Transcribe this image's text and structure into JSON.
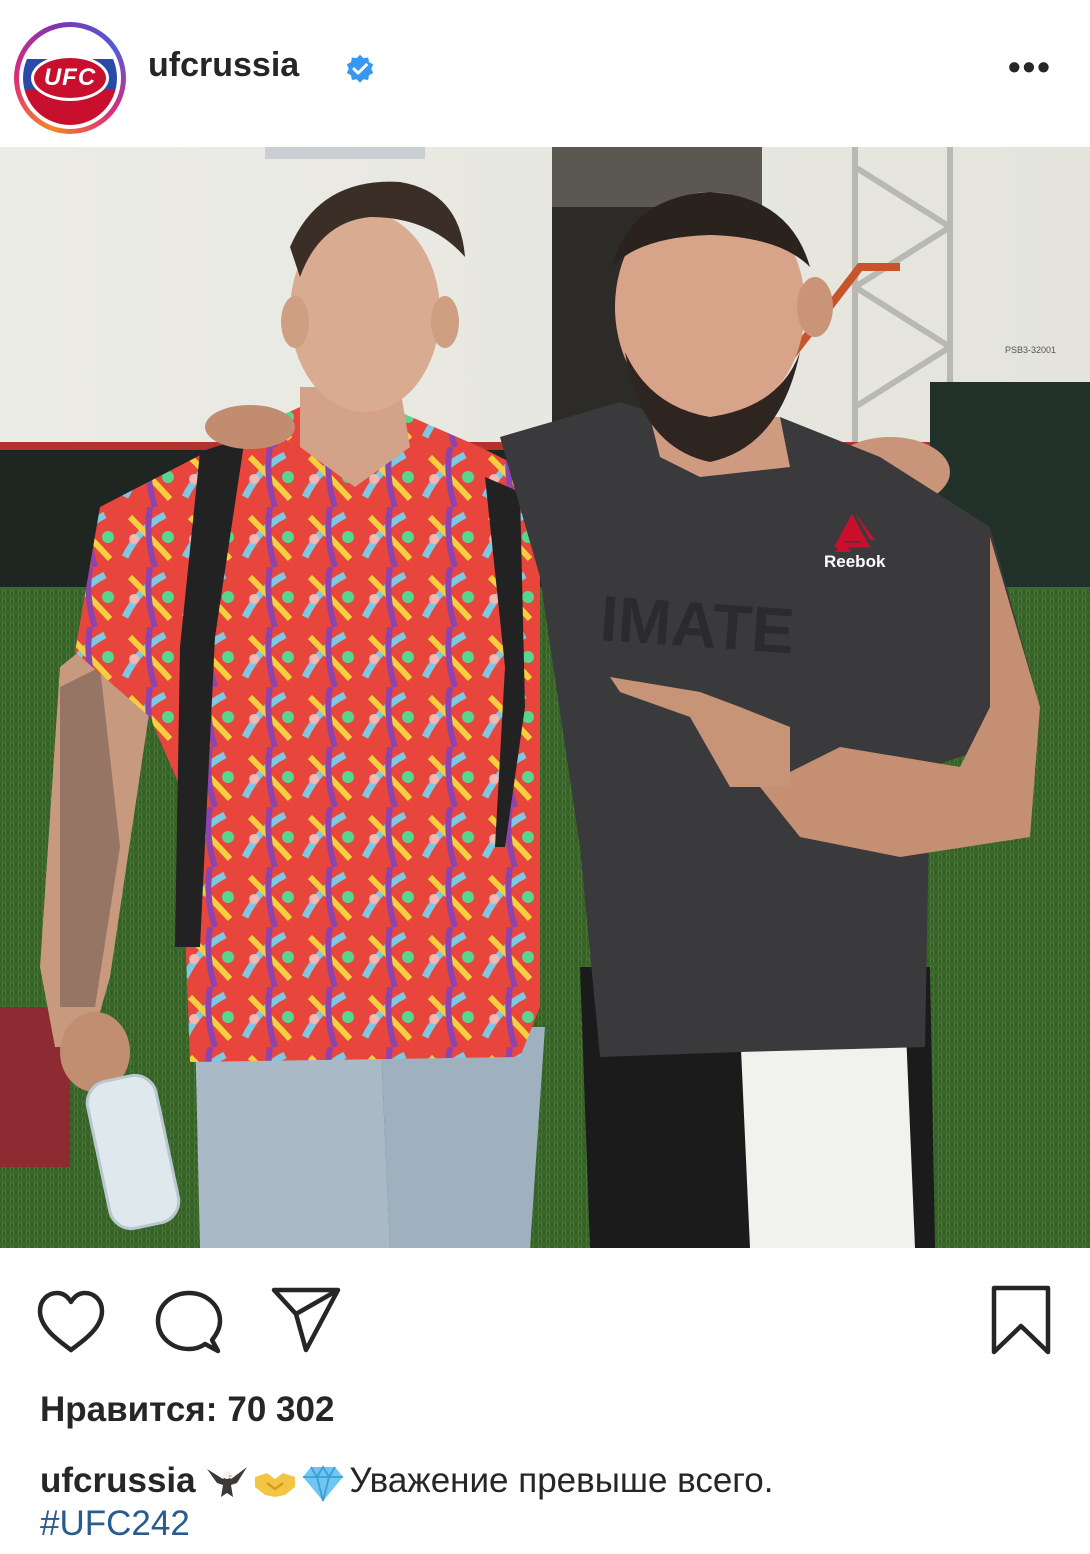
{
  "header": {
    "username": "ufcrussia",
    "avatar_text": "UFC",
    "more_label": "•••"
  },
  "post": {
    "likes_label": "Нравится:",
    "likes_count": "70 302",
    "caption_user": "ufcrussia",
    "caption_text": "Уважение превыше всего.",
    "hashtag": "#UFC242",
    "emojis": [
      "eagle-emoji",
      "handshake-emoji",
      "gem-emoji"
    ],
    "photo_text": {
      "logo": "Reebok",
      "shirt": "IMATE",
      "wall": "PSB3-32001"
    }
  },
  "colors": {
    "text": "#262626",
    "hashtag": "#2a5b8f",
    "verified": "#3897f0",
    "ufc_red": "#c8102e"
  }
}
